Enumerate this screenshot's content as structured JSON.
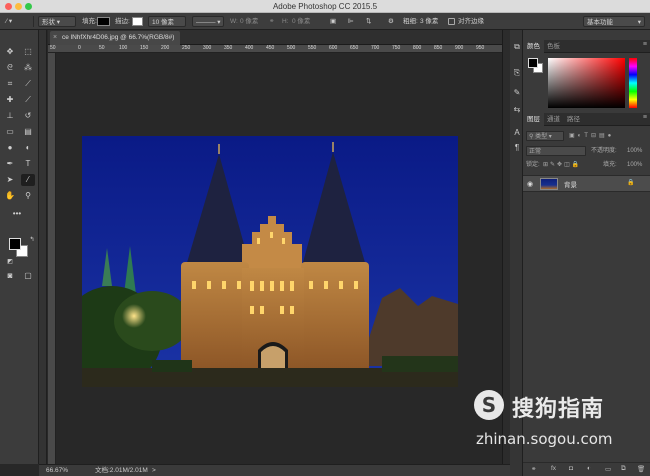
{
  "app": {
    "title": "Adobe Photoshop CC 2015.5"
  },
  "options": {
    "mode": "形状",
    "fill_label": "填充:",
    "stroke_label": "描边:",
    "stroke_width": "10 像素",
    "w_label": "W:",
    "w_value": "0 像素",
    "h_label": "H:",
    "h_value": "0 像素",
    "weight_label": "粗细:",
    "weight_value": "3 像素",
    "align_edges": "对齐边缘",
    "workspace": "基本功能"
  },
  "document": {
    "tab_title": "ce lNhfXhr4D06.jpg @ 66.7%(RGB/8#)",
    "ruler_labels": [
      "50",
      "0",
      "50",
      "100",
      "150",
      "200",
      "250",
      "300",
      "350",
      "400",
      "450",
      "500",
      "550",
      "600",
      "650",
      "700",
      "750",
      "800",
      "850",
      "900",
      "950"
    ]
  },
  "status": {
    "zoom": "66.67%",
    "doc_size": "文档:2.01M/2.01M"
  },
  "panels": {
    "color_tabs": [
      "颜色",
      "色板"
    ],
    "layer_tabs": [
      "图层",
      "通道",
      "路径"
    ],
    "kind_filter": "类型",
    "blend_mode": "正常",
    "opacity_label": "不透明度:",
    "opacity_value": "100%",
    "lock_label": "锁定:",
    "fill_label": "填充:",
    "fill_value": "100%",
    "layer_name": "背景"
  },
  "watermark": {
    "logo": "S",
    "chinese": "搜狗指南",
    "url": "zhinan.sogou.com"
  },
  "icons": [
    "move-icon",
    "marquee-icon",
    "lasso-icon",
    "magic-wand-icon",
    "crop-icon",
    "eyedropper-icon",
    "healing-icon",
    "brush-icon",
    "stamp-icon",
    "history-brush-icon",
    "eraser-icon",
    "gradient-icon",
    "blur-icon",
    "dodge-icon",
    "pen-icon",
    "type-icon",
    "path-select-icon",
    "line-icon",
    "hand-icon",
    "zoom-icon",
    "eye-icon",
    "lock-icon"
  ],
  "colors": {
    "sky": "#12239a",
    "wall": "#b77a3c",
    "panel": "#3a3a3a"
  }
}
